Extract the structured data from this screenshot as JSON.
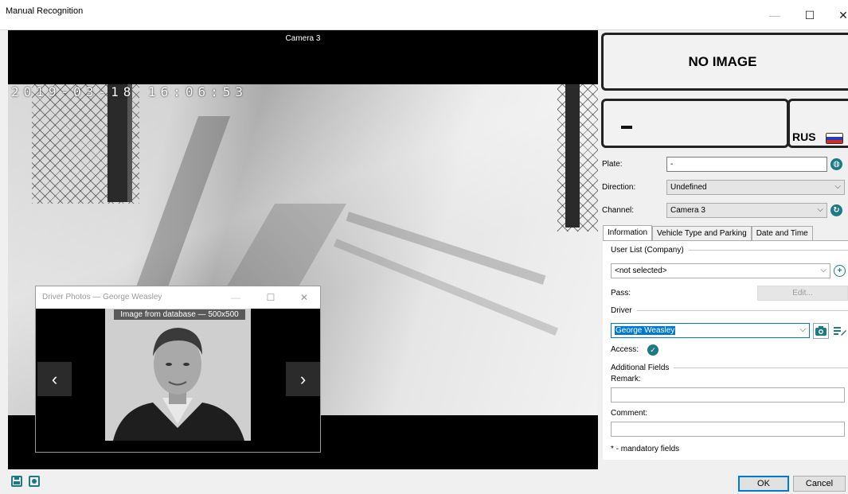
{
  "window": {
    "title": "Manual Recognition",
    "minimize_glyph": "—",
    "maximize_glyph": "☐",
    "close_glyph": "✕"
  },
  "video": {
    "camera_label": "Camera 3",
    "timestamp": "2019-03-18  16:06:53"
  },
  "driver_photos": {
    "title": "Driver Photos — George Weasley",
    "caption": "Image from database — 500x500",
    "prev_glyph": "‹",
    "next_glyph": "›",
    "minimize_glyph": "—",
    "maximize_glyph": "☐",
    "close_glyph": "✕"
  },
  "recognition": {
    "no_image_text": "NO IMAGE",
    "country_code": "RUS",
    "flag_colors": [
      "#ffffff",
      "#1c3fbf",
      "#d52b1e"
    ]
  },
  "form": {
    "plate_label": "Plate:",
    "plate_value": "-",
    "direction_label": "Direction:",
    "direction_value": "Undefined",
    "channel_label": "Channel:",
    "channel_value": "Camera 3"
  },
  "tabs": [
    "Information",
    "Vehicle Type and Parking",
    "Date and Time"
  ],
  "info": {
    "user_list_label": "User List (Company)",
    "user_list_value": "<not selected>",
    "pass_label": "Pass:",
    "edit_label": "Edit...",
    "driver_label": "Driver",
    "driver_value": "George Weasley",
    "access_label": "Access:",
    "additional_label": "Additional Fields",
    "remark_label": "Remark:",
    "remark_value": "",
    "comment_label": "Comment:",
    "comment_value": "",
    "mandatory_note": "* - mandatory fields"
  },
  "footer": {
    "ok_label": "OK",
    "cancel_label": "Cancel"
  },
  "icons": {
    "globe": "globe-icon",
    "refresh": "refresh-icon",
    "add": "add-icon",
    "camera": "camera-icon",
    "edit_list": "edit-list-icon",
    "check": "check-icon",
    "save": "save-icon",
    "snapshot": "snapshot-icon"
  },
  "colors": {
    "accent": "#1c7a85",
    "selection": "#0078d7"
  }
}
